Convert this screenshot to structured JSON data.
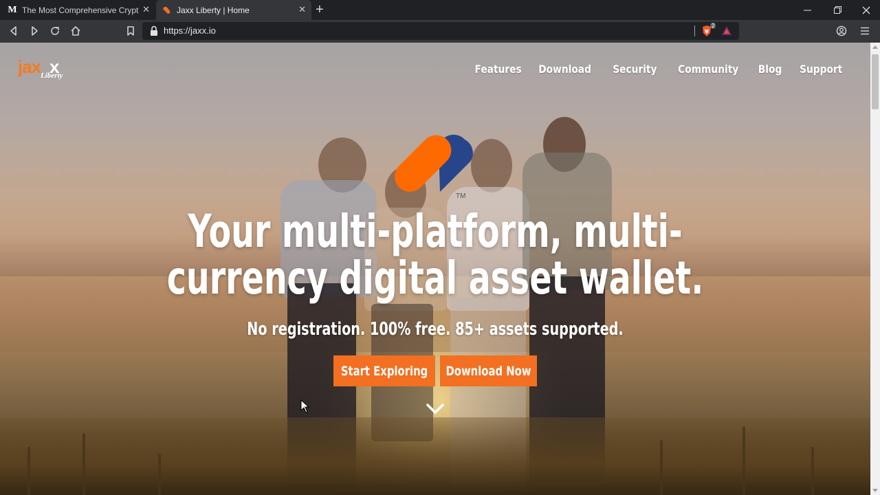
{
  "browser": {
    "tabs": [
      {
        "favicon": "medium-icon",
        "favicon_glyph": "M",
        "title": "The Most Comprehensive Cryptoc",
        "active": false
      },
      {
        "favicon": "jaxx-icon",
        "title": "Jaxx Liberty | Home",
        "active": true
      }
    ],
    "new_tab_label": "+",
    "close_glyph": "✕",
    "url": "https://jaxx.io",
    "brave_badge": "2"
  },
  "site": {
    "logo_primary": "jax",
    "logo_x": "x",
    "logo_secondary": "Liberty",
    "nav": [
      "Features",
      "Download",
      "Security",
      "Community",
      "Blog",
      "Support"
    ],
    "trademark": "TM",
    "headline": "Your multi-platform, multi-currency digital asset wallet.",
    "subheadline": "No registration. 100% free. 85+ assets supported.",
    "cta_primary": "Start Exploring",
    "cta_secondary": "Download Now"
  },
  "colors": {
    "accent": "#f36f21",
    "logo_orange": "#f47b20",
    "heart_orange": "#ff6a00",
    "heart_blue": "#1f3f8a",
    "chrome_dark": "#202124",
    "chrome_mid": "#35363a"
  }
}
